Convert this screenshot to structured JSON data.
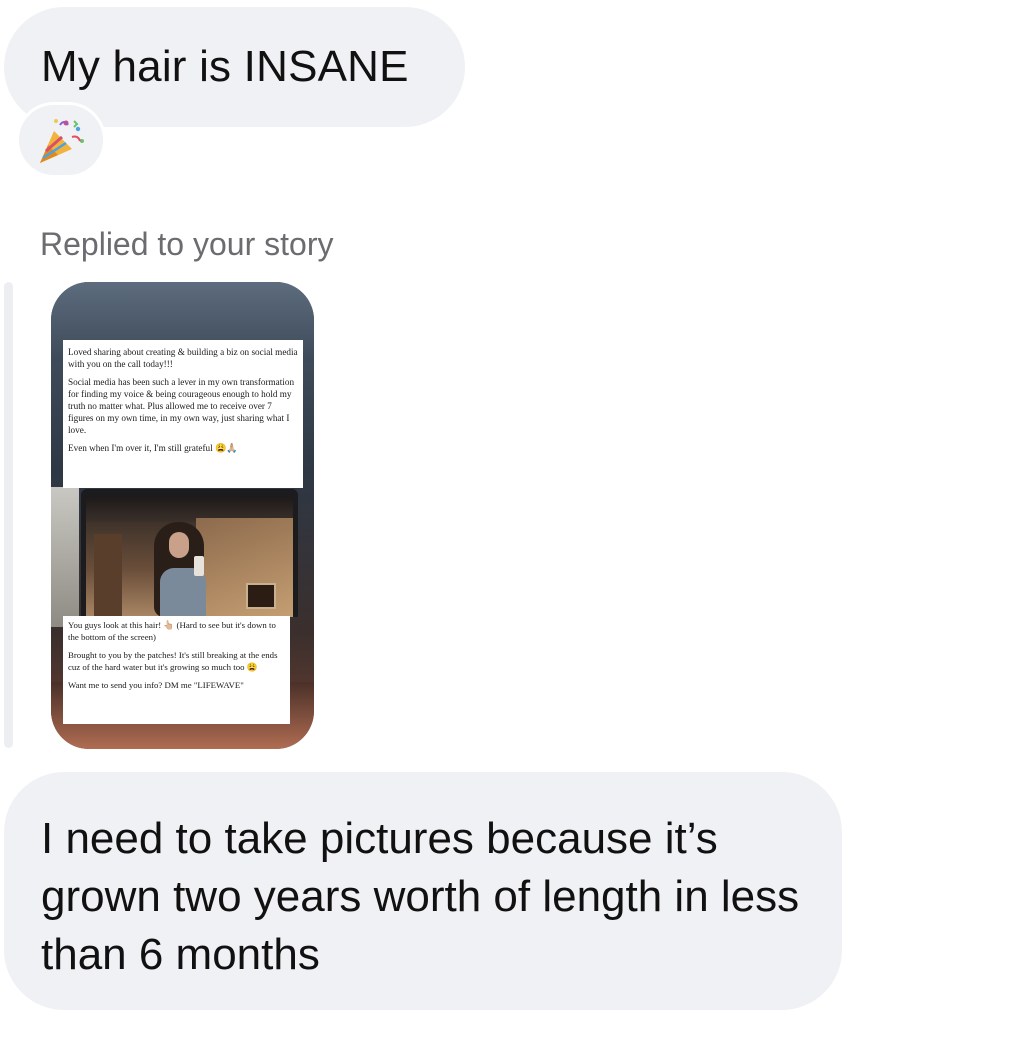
{
  "messages": {
    "first": {
      "text": "My hair is INSANE",
      "reaction_icon": "party-popper-icon"
    },
    "story_reply": {
      "label": "Replied to your story",
      "story_caption_top": [
        "Loved sharing about creating & building a biz on social media with you on the call today!!!",
        "Social media has been such a lever in my own transformation for finding my voice & being courageous enough to hold my truth no matter what. Plus allowed me to receive over 7 figures on my own time, in my own way, just sharing what I love.",
        "Even when I'm over it, I'm still grateful 😩🙏🏼"
      ],
      "story_caption_bottom": [
        "You guys look at this hair! 👆🏼 (Hard to see but it's down to the bottom of the screen)",
        "Brought to you by the patches! It's still breaking at the ends cuz of the hard water but it's growing so much too 😩",
        "Want me to send you info? DM me \"LIFEWAVE\""
      ]
    },
    "last": {
      "text": "I need to take pictures because it’s grown two years worth of length in less than 6 months"
    }
  },
  "colors": {
    "bubble_bg": "#eff1f4",
    "label_text": "#6b6b70",
    "message_text": "#111111"
  }
}
